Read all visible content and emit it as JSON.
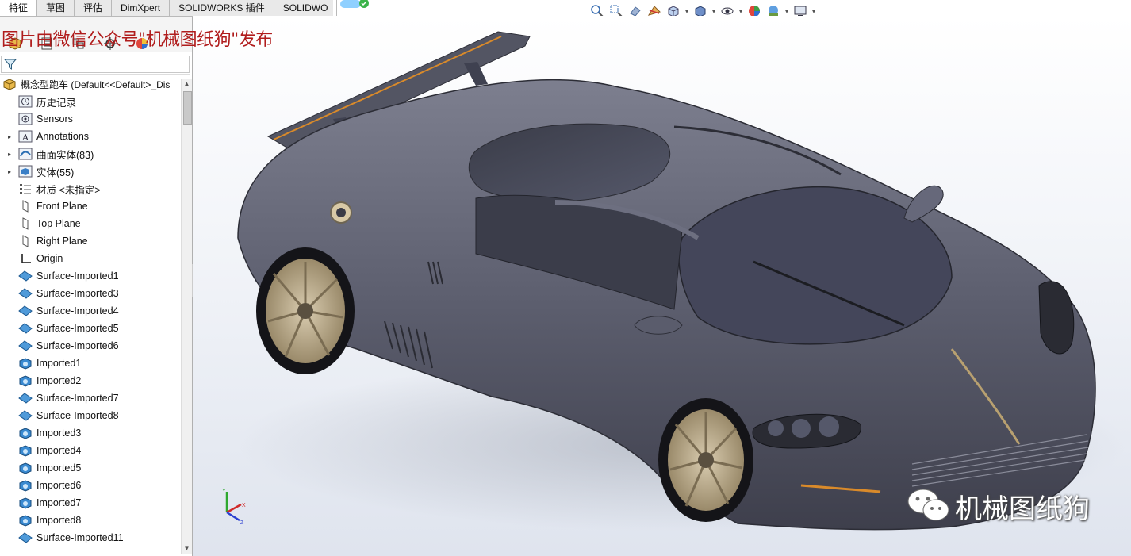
{
  "command_manager": {
    "tabs": [
      "特征",
      "草图",
      "评估",
      "DimXpert",
      "SOLIDWORKS 插件",
      "SOLIDWO"
    ],
    "active_tab": "特征"
  },
  "view_toolbar": {
    "icons": [
      "zoom-to-fit-icon",
      "zoom-to-area-icon",
      "previous-view-icon",
      "section-view-icon",
      "view-orientation-icon",
      "display-style-icon",
      "hide-show-items-icon",
      "edit-appearance-icon",
      "apply-scene-icon",
      "view-settings-icon"
    ]
  },
  "watermark": {
    "top_text": "图片由微信公众号\"机械图纸狗\"发布",
    "bottom_text": "机械图纸狗"
  },
  "feature_tree": {
    "root": "概念型跑车 (Default<<Default>_Dis",
    "items": [
      {
        "label": "历史记录",
        "icon": "history-icon",
        "expandable": false
      },
      {
        "label": "Sensors",
        "icon": "sensors-icon",
        "expandable": false
      },
      {
        "label": "Annotations",
        "icon": "annotations-icon",
        "expandable": true
      },
      {
        "label": "曲面实体(83)",
        "icon": "surface-bodies-icon",
        "expandable": true
      },
      {
        "label": "实体(55)",
        "icon": "solid-bodies-icon",
        "expandable": true
      },
      {
        "label": "材质 <未指定>",
        "icon": "material-icon",
        "expandable": false
      },
      {
        "label": "Front Plane",
        "icon": "plane-icon",
        "expandable": false
      },
      {
        "label": "Top Plane",
        "icon": "plane-icon",
        "expandable": false
      },
      {
        "label": "Right Plane",
        "icon": "plane-icon",
        "expandable": false
      },
      {
        "label": "Origin",
        "icon": "origin-icon",
        "expandable": false
      },
      {
        "label": "Surface-Imported1",
        "icon": "surface-imported-icon",
        "expandable": false
      },
      {
        "label": "Surface-Imported3",
        "icon": "surface-imported-icon",
        "expandable": false
      },
      {
        "label": "Surface-Imported4",
        "icon": "surface-imported-icon",
        "expandable": false
      },
      {
        "label": "Surface-Imported5",
        "icon": "surface-imported-icon",
        "expandable": false
      },
      {
        "label": "Surface-Imported6",
        "icon": "surface-imported-icon",
        "expandable": false
      },
      {
        "label": "Imported1",
        "icon": "imported-solid-icon",
        "expandable": false
      },
      {
        "label": "Imported2",
        "icon": "imported-solid-icon",
        "expandable": false
      },
      {
        "label": "Surface-Imported7",
        "icon": "surface-imported-icon",
        "expandable": false
      },
      {
        "label": "Surface-Imported8",
        "icon": "surface-imported-icon",
        "expandable": false
      },
      {
        "label": "Imported3",
        "icon": "imported-solid-icon",
        "expandable": false
      },
      {
        "label": "Imported4",
        "icon": "imported-solid-icon",
        "expandable": false
      },
      {
        "label": "Imported5",
        "icon": "imported-solid-icon",
        "expandable": false
      },
      {
        "label": "Imported6",
        "icon": "imported-solid-icon",
        "expandable": false
      },
      {
        "label": "Imported7",
        "icon": "imported-solid-icon",
        "expandable": false
      },
      {
        "label": "Imported8",
        "icon": "imported-solid-icon",
        "expandable": false
      },
      {
        "label": "Surface-Imported11",
        "icon": "surface-imported-icon",
        "expandable": false
      }
    ]
  },
  "triad": {
    "x": "X",
    "y": "Y",
    "z": "Z"
  },
  "colors": {
    "watermark_red": "#b01c1c",
    "car_body": "#5d5f6e",
    "wheel": "#b8a88a",
    "accent_orange": "#d98a2a"
  }
}
